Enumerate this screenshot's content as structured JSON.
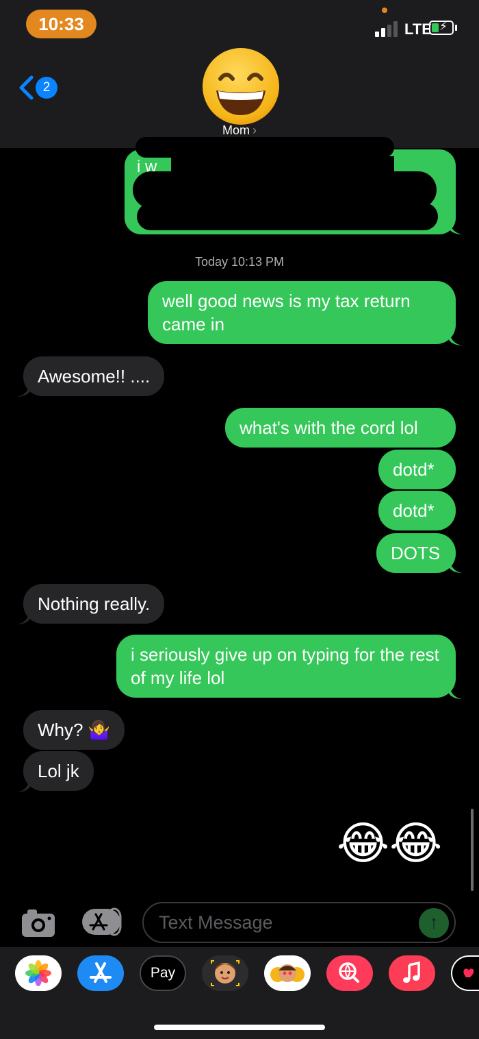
{
  "status_bar": {
    "time": "10:33",
    "network": "LTE"
  },
  "header": {
    "back_count": "2",
    "contact_name": "Mom",
    "avatar_emoji": "😄"
  },
  "redacted_message": {
    "partial_text": "i w"
  },
  "thread": {
    "timestamp": "Today 10:13 PM",
    "messages": [
      {
        "from": "me",
        "text": "well good news is my tax return came in"
      },
      {
        "from": "them",
        "text": "Awesome!! ...."
      },
      {
        "from": "me",
        "text": "what's with the cord lol"
      },
      {
        "from": "me",
        "text": "dotd*"
      },
      {
        "from": "me",
        "text": "dotd*"
      },
      {
        "from": "me",
        "text": "DOTS"
      },
      {
        "from": "them",
        "text": "Nothing really."
      },
      {
        "from": "me",
        "text": "i seriously give up on typing for the rest of my life lol"
      },
      {
        "from": "them",
        "text": "Why? 🤷‍♀️"
      },
      {
        "from": "them",
        "text": "Lol jk"
      },
      {
        "from": "me",
        "text": "😂😂"
      }
    ]
  },
  "composer": {
    "placeholder": "Text Message"
  },
  "app_drawer": {
    "apps": [
      "photos-icon",
      "appstore-icon",
      "apple-pay",
      "memoji-icon",
      "animoji-icon",
      "image-search-icon",
      "music-icon",
      "digital-touch-icon"
    ],
    "apple_pay_label": "Pay"
  },
  "colors": {
    "sent": "#35c759",
    "received": "#262629",
    "accent": "#0a84ff",
    "status_pill": "#e3871f"
  }
}
